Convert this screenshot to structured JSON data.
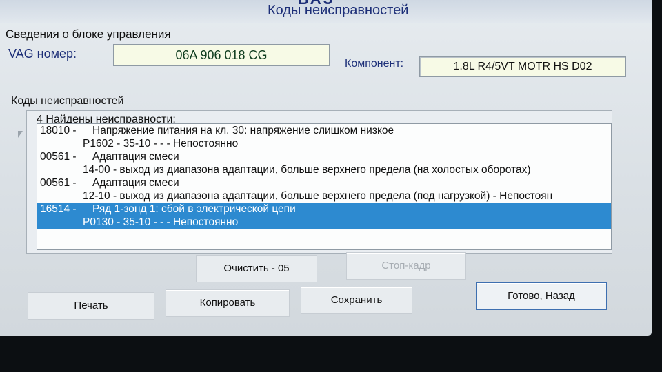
{
  "window": {
    "brand_fragment": "ВАЗ",
    "title": "Коды неисправностей"
  },
  "control_unit": {
    "section_label": "Сведения о блоке управления",
    "vag_label": "VAG номер:",
    "vag_number": "06A 906 018 CG",
    "component_label": "Компонент:",
    "component_value": "1.8L R4/5VT MOTR HS D02"
  },
  "faults": {
    "section_label": "Коды неисправностей",
    "header": "4 Найдены неисправности:",
    "rows": [
      {
        "code": "18010 -",
        "desc": "Напряжение питания на кл. 30: напряжение слишком низкое"
      },
      {
        "sub": "P1602 - 35-10 -   - - Непостоянно"
      },
      {
        "code": "00561 -",
        "desc": "Адаптация смеси"
      },
      {
        "sub": "14-00 -   выход из диапазона адаптации, больше верхнего предела (на холостых оборотах)"
      },
      {
        "code": "00561 -",
        "desc": "Адаптация смеси"
      },
      {
        "sub": "12-10 -   выход из диапазона адаптации, больше верхнего предела (под нагрузкой) - Непостоян"
      },
      {
        "code": "16514 -",
        "desc": "Ряд 1-зонд 1: сбой в электрической цепи",
        "selected": true
      },
      {
        "sub": "P0130 - 35-10 -   - - Непостоянно",
        "selected": true
      }
    ]
  },
  "buttons": {
    "clear": "Очистить - 05",
    "freeze_frame": "Стоп-кадр",
    "print": "Печать",
    "copy": "Копировать",
    "save": "Сохранить",
    "done_back": "Готово, Назад"
  },
  "colors": {
    "title_blue": "#1d2f78",
    "selection": "#2d8ad0",
    "value_bg": "#f7fae6"
  }
}
